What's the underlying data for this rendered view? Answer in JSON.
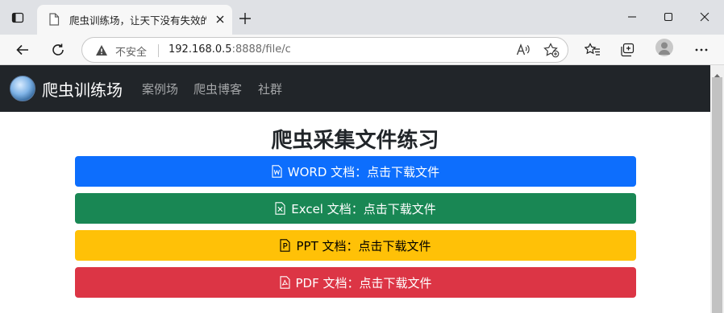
{
  "browser": {
    "tab_title": "爬虫训练场，让天下没有失效的爬虫",
    "address": {
      "security_label": "不安全",
      "host": "192.168.0.5",
      "rest": ":8888/file/c"
    }
  },
  "site": {
    "brand": "爬虫训练场",
    "nav": [
      {
        "label": "案例场"
      },
      {
        "label": "爬虫博客"
      },
      {
        "label": "社群"
      }
    ]
  },
  "page": {
    "heading": "爬虫采集文件练习",
    "buttons": [
      {
        "label": "WORD 文档：点击下载文件",
        "icon": "file-word-icon",
        "bg": "#0d6efd",
        "fg": "#ffffff"
      },
      {
        "label": "Excel 文档：点击下载文件",
        "icon": "file-excel-icon",
        "bg": "#198754",
        "fg": "#ffffff"
      },
      {
        "label": "PPT 文档：点击下载文件",
        "icon": "file-ppt-icon",
        "bg": "#ffc107",
        "fg": "#000000"
      },
      {
        "label": "PDF 文档：点击下载文件",
        "icon": "file-pdf-icon",
        "bg": "#dc3545",
        "fg": "#ffffff"
      }
    ]
  },
  "colors": {
    "navbar": "#212529",
    "tabbar": "#dfe1e5",
    "toolbar": "#f7f7f7"
  }
}
